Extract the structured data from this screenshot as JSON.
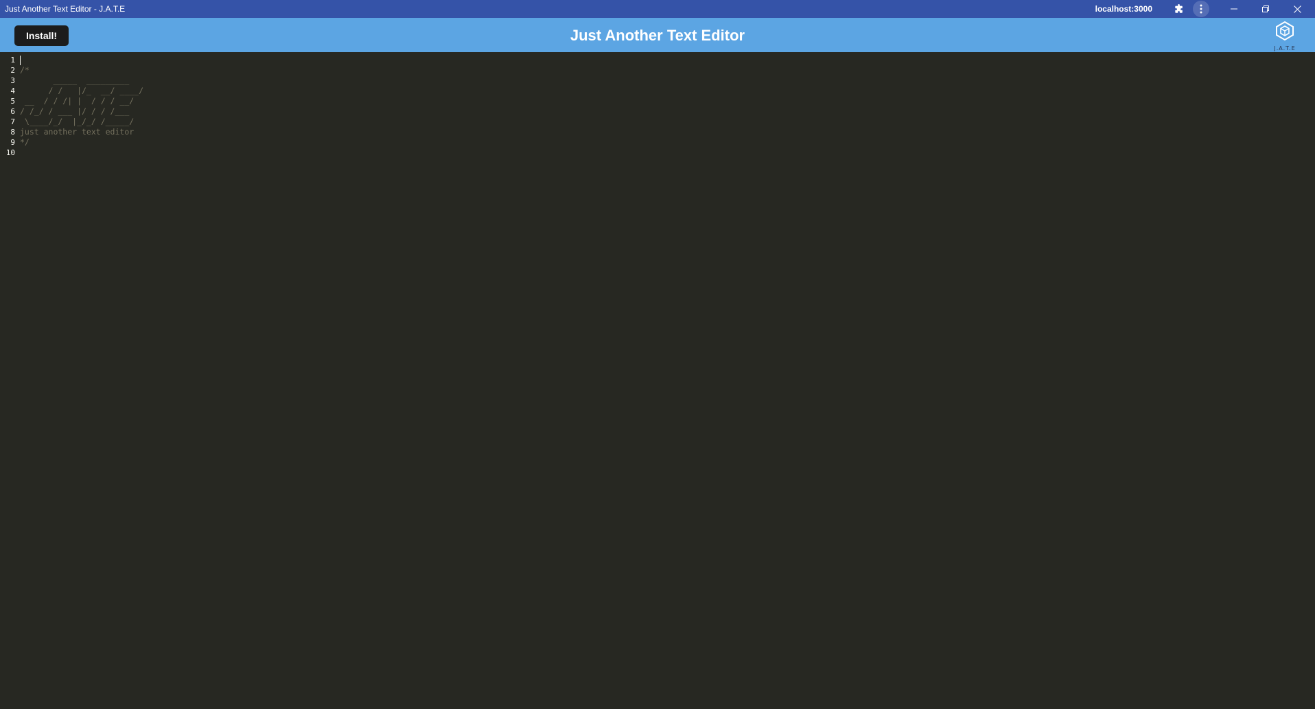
{
  "window": {
    "title": "Just Another Text Editor - J.A.T.E",
    "origin": "localhost:3000"
  },
  "header": {
    "install_label": "Install!",
    "heading": "Just Another Text Editor",
    "logo_text": "J.A.T.E"
  },
  "editor": {
    "lines": [
      {
        "number": "1",
        "text": ""
      },
      {
        "number": "2",
        "text": "/*"
      },
      {
        "number": "3",
        "text": "       _____  _________"
      },
      {
        "number": "4",
        "text": "      / /   |/_  __/ ____/"
      },
      {
        "number": "5",
        "text": " __  / / /| |  / / / __/"
      },
      {
        "number": "6",
        "text": "/ /_/ / ___ |/ / / /___"
      },
      {
        "number": "7",
        "text": " \\____/_/  |_/_/ /_____/"
      },
      {
        "number": "8",
        "text": "just another text editor"
      },
      {
        "number": "9",
        "text": "*/"
      },
      {
        "number": "10",
        "text": ""
      }
    ]
  },
  "colors": {
    "titlebar": "#3553a8",
    "appbar": "#5ca5e3",
    "editor_bg": "#272822",
    "comment": "#75715e",
    "line_number": "#f8f8f2"
  },
  "icons": {
    "extensions": "puzzle-icon",
    "menu": "kebab-menu-icon",
    "minimize": "minimize-icon",
    "restore": "restore-icon",
    "close": "close-icon",
    "logo": "jate-cube-logo"
  }
}
